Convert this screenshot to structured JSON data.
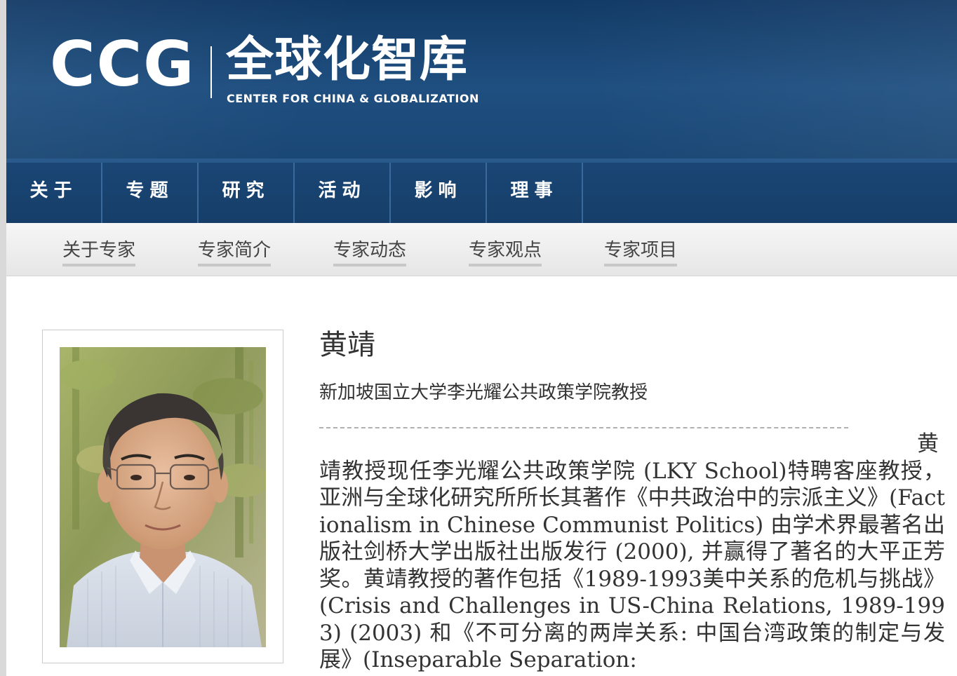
{
  "header": {
    "logo_text": "CCG",
    "logo_cn": "全球化智库",
    "logo_en": "CENTER FOR CHINA & GLOBALIZATION"
  },
  "main_nav": {
    "items": [
      {
        "label": "关于"
      },
      {
        "label": "专题"
      },
      {
        "label": "研究"
      },
      {
        "label": "活动"
      },
      {
        "label": "影响"
      },
      {
        "label": "理事"
      }
    ]
  },
  "sub_nav": {
    "items": [
      {
        "label": "关于专家"
      },
      {
        "label": "专家简介"
      },
      {
        "label": "专家动态"
      },
      {
        "label": "专家观点"
      },
      {
        "label": "专家项目"
      }
    ]
  },
  "expert": {
    "name": "黄靖",
    "title": "新加坡国立大学李光耀公共政策学院教授",
    "bio": "黄靖教授现任李光耀公共政策学院 (LKY School)特聘客座教授，亚洲与全球化研究所所长其著作《中共政治中的宗派主义》(Factionalism in Chinese Communist Politics) 由学术界最著名出版社剑桥大学出版社出版发行 (2000), 并赢得了著名的大平正芳奖。黄靖教授的著作包括《1989-1993美中关系的危机与挑战》(Crisis and Challenges in US-China Relations, 1989-1993) (2003) 和《不可分离的两岸关系: 中国台湾政策的制定与发展》(Inseparable Separation:"
  },
  "colors": {
    "header_blue": "#1f4f80",
    "nav_blue": "#163e69",
    "subnav_gray": "#e6e6e6",
    "text": "#333333"
  }
}
